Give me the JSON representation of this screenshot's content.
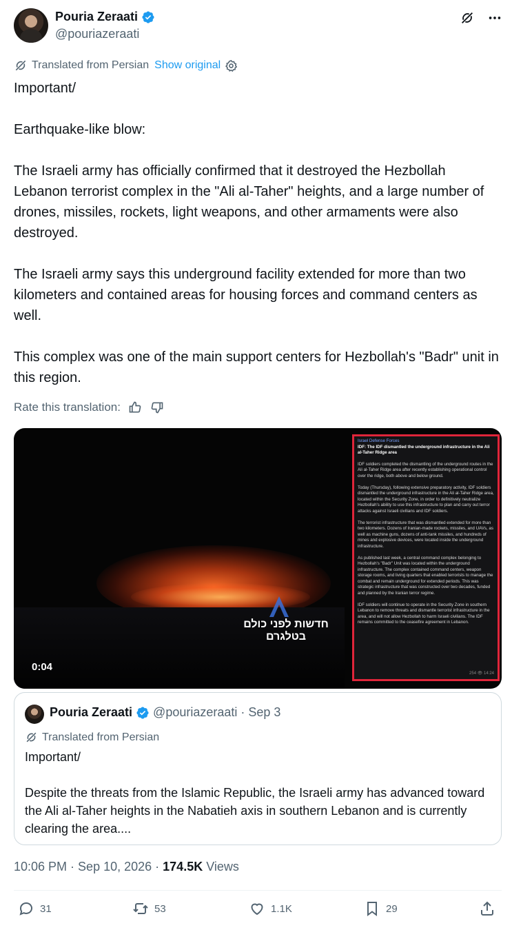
{
  "colors": {
    "accent": "#1d9bf0",
    "muted": "#536471",
    "text": "#0f1419",
    "highlight_border": "#e0253a"
  },
  "post": {
    "author_name": "Pouria Zeraati",
    "author_handle": "@pouriazeraati",
    "translated_label": "Translated from Persian",
    "show_original": "Show original",
    "paragraphs": [
      "Important/",
      "Earthquake-like blow:",
      "The Israeli army has officially confirmed that it destroyed the Hezbollah Lebanon terrorist complex in the \"Ali al-Taher\" heights, and a large number of drones, missiles, rockets, light weapons, and other armaments were also destroyed.",
      "The Israeli army says this underground facility extended for more than two kilometers and contained areas for housing forces and command centers as well.",
      "This complex was one of the main support centers for Hezbollah's \"Badr\" unit in this region."
    ],
    "rate_label": "Rate this translation:"
  },
  "media": {
    "duration": "0:04",
    "watermark": "חדשות לפני כולם בטלגרם",
    "overlay": {
      "source": "Israel Defense Forces",
      "title": "IDF: The IDF dismantled the underground infrastructure in the Ali al-Taher Ridge area",
      "paragraphs": [
        "IDF soldiers completed the dismantling of the underground routes in the Ali al-Taher Ridge area after recently establishing operational control over the ridge, both above and below ground.",
        "Today (Thursday), following extensive preparatory activity, IDF soldiers dismantled the underground infrastructure in the Ali al-Taher Ridge area, located within the Security Zone, in order to definitively neutralize Hezbollah's ability to use this infrastructure to plan and carry out terror attacks against Israeli civilians and IDF soldiers.",
        "The terrorist infrastructure that was dismantled extended for more than two kilometers. Dozens of Iranian-made rockets, missiles, and UAVs, as well as machine guns, dozens of anti-tank missiles, and hundreds of mines and explosive devices, were located inside the underground infrastructure.",
        "As published last week, a central command complex belonging to Hezbollah's \"Badr\" Unit was located within the underground infrastructure. The complex contained command centers, weapon storage rooms, and living quarters that enabled terrorists to manage the combat and remain underground for extended periods. This was strategic infrastructure that was constructed over two decades, funded and planned by the Iranian terror regime.",
        "IDF soldiers will continue to operate in the Security Zone in southern Lebanon to remove threats and dismantle terrorist infrastructure in the area, and will not allow Hezbollah to harm Israeli civilians. The IDF remains committed to the ceasefire agreement in Lebanon."
      ],
      "meta": "254 👁 14:24"
    }
  },
  "quote": {
    "author_name": "Pouria Zeraati",
    "author_handle": "@pouriazeraati",
    "separator": "·",
    "date": "Sep 3",
    "translated_label": "Translated from Persian",
    "line1": "Important/",
    "line2": "Despite the threats from the Islamic Republic, the Israeli army has advanced toward the Ali al-Taher heights in the Nabatieh axis in southern Lebanon and is currently clearing the area...."
  },
  "meta": {
    "time": "10:06 PM",
    "sep1": "·",
    "date": "Sep 10, 2026",
    "sep2": "·",
    "views_count": "174.5K",
    "views_label": "Views"
  },
  "actions": {
    "replies": "31",
    "reposts": "53",
    "likes": "1.1K",
    "bookmarks": "29"
  },
  "icons": [
    "verified-badge-icon",
    "grok-icon",
    "more-icon",
    "translate-icon",
    "settings-icon",
    "thumbs-up-icon",
    "thumbs-down-icon",
    "reply-icon",
    "repost-icon",
    "like-icon",
    "bookmark-icon",
    "share-icon"
  ]
}
